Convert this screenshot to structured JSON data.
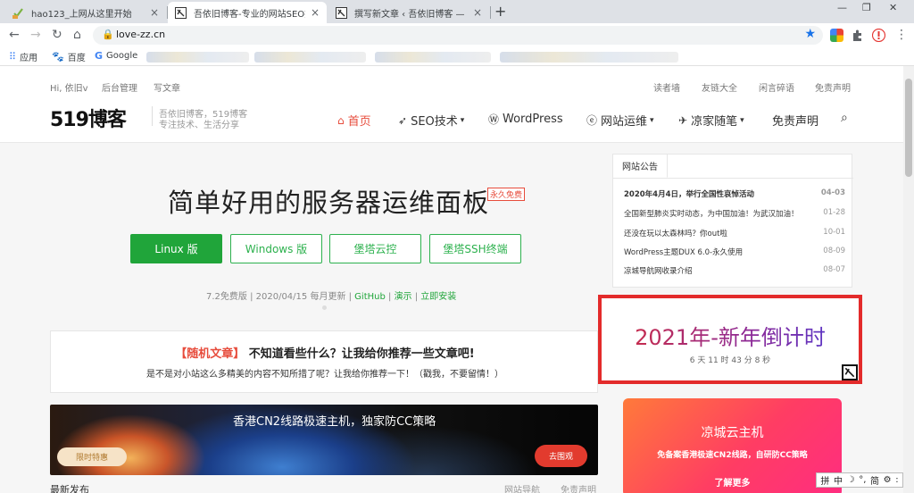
{
  "browser": {
    "tabs": [
      {
        "title": "hao123_上网从这里开始",
        "close": "×"
      },
      {
        "title": "吾依旧博客-专业的网站SEO技术",
        "close": "×"
      },
      {
        "title": "撰写新文章 ‹ 吾依旧博客 — Wo",
        "close": "×"
      }
    ],
    "new_tab": "+",
    "window_controls": [
      "—",
      "❐",
      "✕"
    ],
    "nav": {
      "back": "←",
      "forward": "→",
      "reload": "↻",
      "home": "⌂"
    },
    "url": "love-zz.cn",
    "lock": "🔒",
    "bookmark_star": "★",
    "menu": "⋮",
    "bookmarks": [
      {
        "label": "应用",
        "icon": "apps-grid-icon",
        "glyph": "⠿"
      },
      {
        "label": "百度",
        "icon": "baidu-paw-icon",
        "glyph": "🐾"
      },
      {
        "label": "Google",
        "icon": "google-g-icon",
        "glyph": "G"
      }
    ]
  },
  "site": {
    "toplinks_left": [
      "Hi, 依旧v",
      "后台管理",
      "写文章"
    ],
    "toplinks_right": [
      "读者墙",
      "友链大全",
      "闲言碎语",
      "免责声明"
    ],
    "logo": "519博客",
    "slogan": [
      "吾依旧博客，519博客",
      "专注技术、生活分享"
    ],
    "nav": [
      {
        "label": "首页",
        "icon": "home-icon",
        "glyph": "⌂",
        "caret": ""
      },
      {
        "label": "SEO技术",
        "icon": "rocket-icon",
        "glyph": "➶",
        "caret": "▾"
      },
      {
        "label": "WordPress",
        "icon": "wordpress-icon",
        "glyph": "Ⓦ",
        "caret": ""
      },
      {
        "label": "网站运维",
        "icon": "edge-e-icon",
        "glyph": "ⓔ",
        "caret": "▾"
      },
      {
        "label": "凉家随笔",
        "icon": "paper-plane-icon",
        "glyph": "✈",
        "caret": "▾"
      },
      {
        "label": "免责声明",
        "icon": "",
        "glyph": "",
        "caret": ""
      }
    ],
    "search_glyph": "⌕"
  },
  "hero": {
    "title": "简单好用的服务器运维面板",
    "badge": "永久免费",
    "buttons": [
      "Linux 版",
      "Windows 版",
      "堡塔云控",
      "堡塔SSH终端"
    ],
    "meta_prefix": "7.2免费版 | 2020/04/15 每月更新 | ",
    "meta_links": [
      "GitHub",
      "演示",
      "立即安装"
    ],
    "meta_sep": " | "
  },
  "random": {
    "tag": "【随机文章】",
    "title": "不知道看些什么？让我给你推荐一些文章吧!",
    "sub": "是不是对小站这么多精美的内容不知所措了呢？让我给你推荐一下！（戳我，不要留情！）"
  },
  "banner": {
    "text": "香港CN2线路极速主机，独家防CC策略",
    "tag": "限时特惠",
    "button": "去围观"
  },
  "latest": {
    "title": "最新发布",
    "right": [
      "网站导航",
      "免责声明"
    ]
  },
  "notice": {
    "tab": "网站公告",
    "items": [
      {
        "title": "2020年4月4日，举行全国性哀悼活动",
        "date": "04-03",
        "bold": true
      },
      {
        "title": "全国新型肺炎实时动态，为中国加油！为武汉加油！",
        "date": "01-28",
        "bold": false
      },
      {
        "title": "还没在玩以太森林吗？你out啦",
        "date": "10-01",
        "bold": false
      },
      {
        "title": "WordPress主题DUX 6.0-永久使用",
        "date": "08-09",
        "bold": false
      },
      {
        "title": "凉城导航网收录介绍",
        "date": "08-07",
        "bold": false
      }
    ]
  },
  "countdown": {
    "title": "2021年-新年倒计时",
    "remaining": "6 天 11 时 43 分 8 秒"
  },
  "promo": {
    "title": "凉城云主机",
    "sub": "免备案香港极速CN2线路，自研防CC策略",
    "more": "了解更多"
  },
  "ime": [
    "拼",
    "中",
    "☽",
    "°,",
    "简",
    "⚙",
    ":"
  ],
  "colors": {
    "accent": "#e74c3c",
    "green": "#20a53a",
    "countdown_border": "#e32b2b"
  }
}
